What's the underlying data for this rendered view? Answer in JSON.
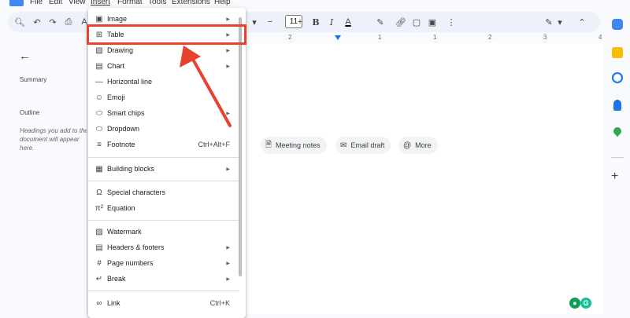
{
  "menubar": {
    "items": [
      "File",
      "Edit",
      "View",
      "Insert",
      "Format",
      "Tools",
      "Extensions",
      "Help"
    ],
    "active": "Insert"
  },
  "toolbar": {
    "font_size": "11",
    "minus": "−",
    "plus": "+",
    "bold": "B",
    "italic": "I",
    "text_color": "A"
  },
  "ruler": {
    "numbers": [
      "2",
      "1",
      "1",
      "2",
      "3",
      "4"
    ]
  },
  "sidebar": {
    "summary": "Summary",
    "outline": "Outline",
    "help_text": "Headings you add to the document will appear here."
  },
  "page": {
    "chips": [
      {
        "icon": "document-icon",
        "label": "Meeting notes"
      },
      {
        "icon": "email-icon",
        "label": "Email draft"
      },
      {
        "icon": "at-icon",
        "label": "More"
      }
    ]
  },
  "insert_menu": {
    "items": [
      {
        "label": "Image",
        "icon": "image-icon",
        "submenu": true
      },
      {
        "label": "Table",
        "icon": "table-icon",
        "submenu": true
      },
      {
        "label": "Drawing",
        "icon": "drawing-icon",
        "submenu": true
      },
      {
        "label": "Chart",
        "icon": "chart-icon",
        "submenu": true
      },
      {
        "label": "Horizontal line",
        "icon": "horizontal-line-icon"
      },
      {
        "label": "Emoji",
        "icon": "emoji-icon"
      },
      {
        "label": "Smart chips",
        "icon": "smart-chips-icon",
        "submenu": true
      },
      {
        "label": "Dropdown",
        "icon": "dropdown-icon"
      },
      {
        "label": "Footnote",
        "icon": "footnote-icon",
        "shortcut": "Ctrl+Alt+F"
      },
      {
        "label": "Building blocks",
        "icon": "building-blocks-icon",
        "submenu": true
      },
      {
        "label": "Special characters",
        "icon": "omega-icon"
      },
      {
        "label": "Equation",
        "icon": "pi-icon"
      },
      {
        "label": "Watermark",
        "icon": "watermark-icon"
      },
      {
        "label": "Headers & footers",
        "icon": "headers-footers-icon",
        "submenu": true
      },
      {
        "label": "Page numbers",
        "icon": "hash-icon",
        "submenu": true
      },
      {
        "label": "Break",
        "icon": "break-icon",
        "submenu": true
      },
      {
        "label": "Link",
        "icon": "link-icon",
        "shortcut": "Ctrl+K"
      }
    ]
  },
  "annotation": {
    "highlighted_item": "Table",
    "color": "#e8412e"
  },
  "colors": {
    "accent": "#1a73e8",
    "annotation": "#e8412e",
    "toolbar_bg": "#edf2fa"
  }
}
